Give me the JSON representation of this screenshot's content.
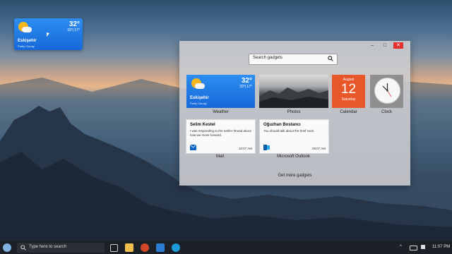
{
  "desktop_weather": {
    "temp": "32°",
    "range": "33°| 17°",
    "city": "Eskişehir",
    "condition": "Partly Cloudy"
  },
  "gadget_window": {
    "controls": [
      "–",
      "□",
      "✕"
    ],
    "search_placeholder": "Search gadgets",
    "footer_link": "Get more gadgets"
  },
  "gadgets": {
    "weather": {
      "label": "Weather",
      "temp": "32°",
      "range": "33°| 17°",
      "city": "Eskişehir",
      "condition": "Partly Cloudy"
    },
    "photos": {
      "label": "Photos"
    },
    "calendar": {
      "label": "Calendar",
      "month": "August",
      "day": "12",
      "weekday": "Saturday"
    },
    "clock": {
      "label": "Clock"
    },
    "mail": {
      "label": "Mail",
      "sender": "Selim Kestel",
      "message": "I was responding to the earlier thread about how we move forward.",
      "time": "10:07 AM"
    },
    "outlook": {
      "label": "Microsoft Outlook",
      "sender": "Oğuzhan Bostancı",
      "message": "You should talk about the brief soon.",
      "time": "08:07 AM"
    }
  },
  "taskbar": {
    "search_placeholder": "Type here to search",
    "time": "11:07 PM",
    "apps": [
      "task-view-icon",
      "file-explorer-icon",
      "powerpoint-icon",
      "photos-icon",
      "edge-icon"
    ]
  }
}
